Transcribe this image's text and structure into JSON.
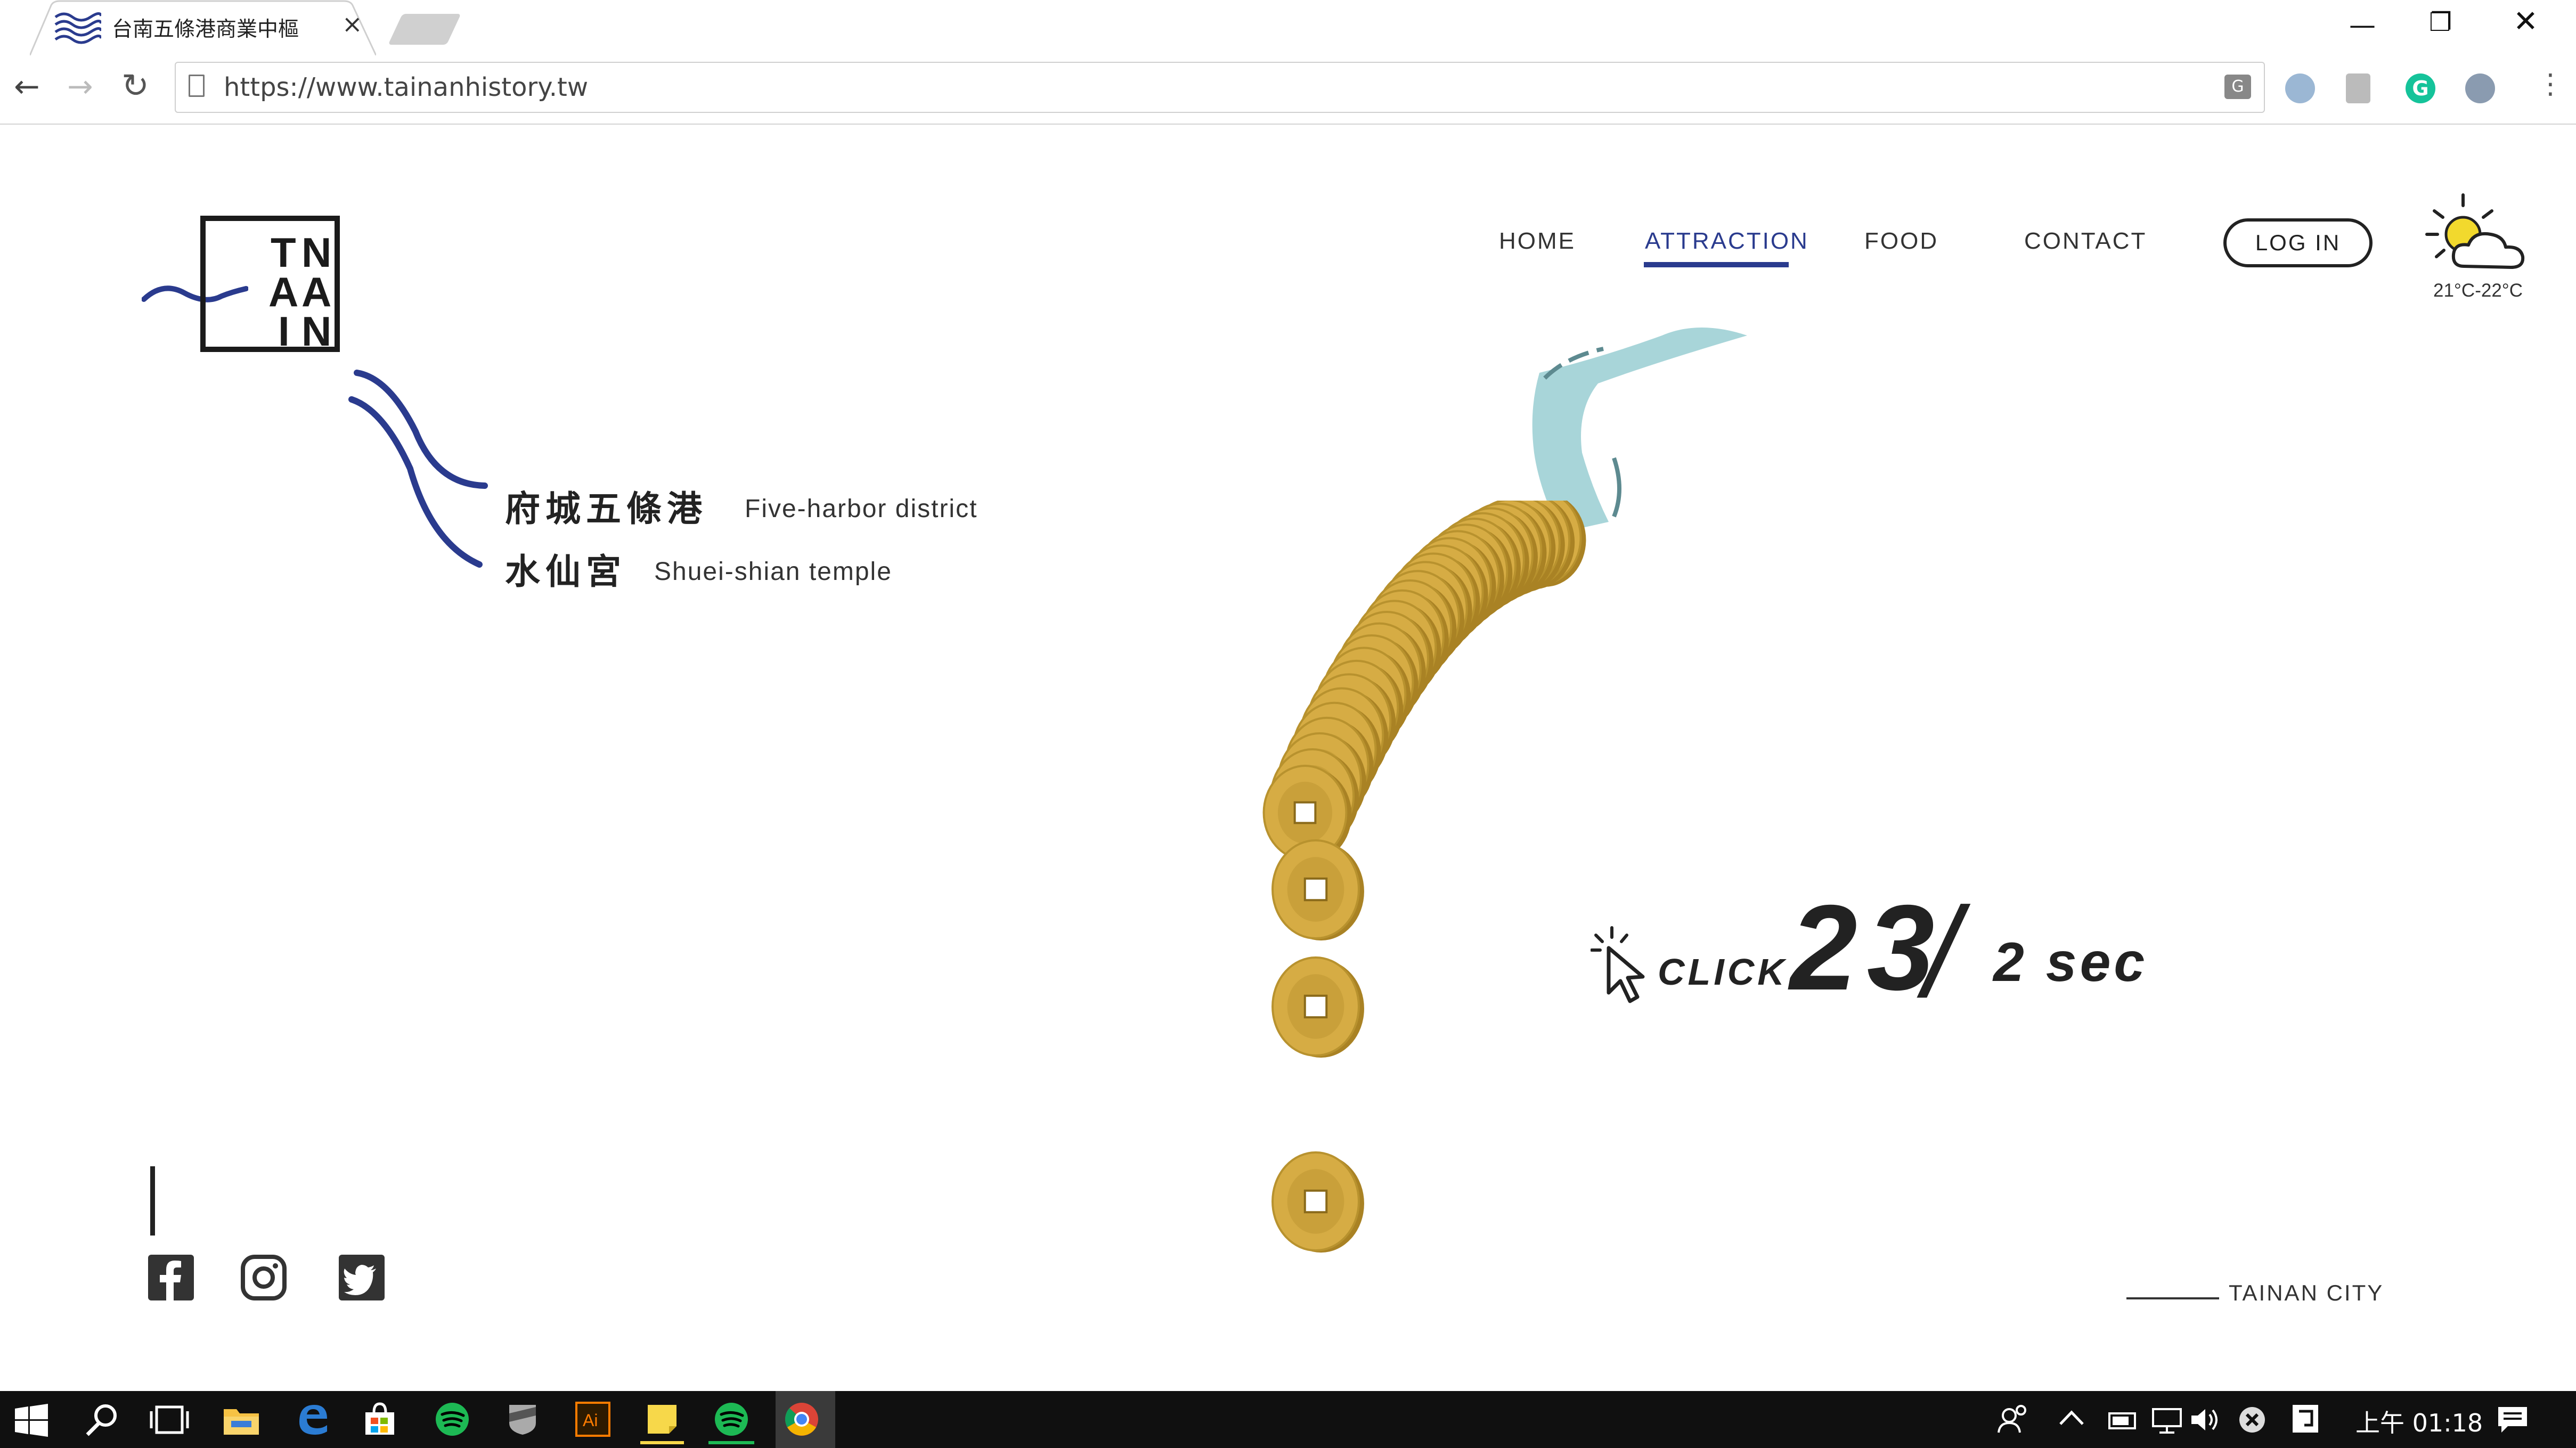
{
  "browser": {
    "tab_title": "台南五條港商業中樞",
    "tab_close": "×",
    "url": "https://www.tainanhistory.tw",
    "back": "←",
    "forward": "→",
    "reload": "↻",
    "menu": "⋮",
    "window_min": "—",
    "window_max": "❐",
    "window_close": "✕",
    "extensions": [
      "translate-icon",
      "extension-icon",
      "grammarly-icon",
      "extension-icon"
    ],
    "grammarly_letter": "G"
  },
  "logo": {
    "letters": [
      "T",
      "N",
      "A",
      "A",
      "I",
      "N"
    ]
  },
  "nav": {
    "items": [
      "HOME",
      "ATTRACTION",
      "FOOD",
      "CONTACT"
    ],
    "active": "ATTRACTION",
    "login": "LOG IN"
  },
  "weather": {
    "icon": "partly-cloudy-icon",
    "temp": "21°C-22°C"
  },
  "places": [
    {
      "zh": "府城五條港",
      "en": "Five-harbor district"
    },
    {
      "zh": "水仙宮",
      "en": "Shuei-shian temple"
    }
  ],
  "counter": {
    "label": "CLICK",
    "value": "23",
    "slash": "/",
    "rate": "2 sec"
  },
  "social": [
    "facebook-icon",
    "instagram-icon",
    "twitter-icon"
  ],
  "footer": {
    "city": "TAINAN CITY"
  },
  "taskbar": {
    "clock": "上午 01:18",
    "apps": [
      "windows-start-icon",
      "search-icon",
      "task-view-icon",
      "file-explorer-icon",
      "edge-icon",
      "store-icon",
      "spotify-icon",
      "app-icon",
      "illustrator-icon",
      "sticky-notes-icon",
      "spotify-icon",
      "chrome-icon"
    ]
  },
  "colors": {
    "accent": "#2a3b8e",
    "coin": "#d6ac44",
    "water": "#a8d5d9"
  }
}
